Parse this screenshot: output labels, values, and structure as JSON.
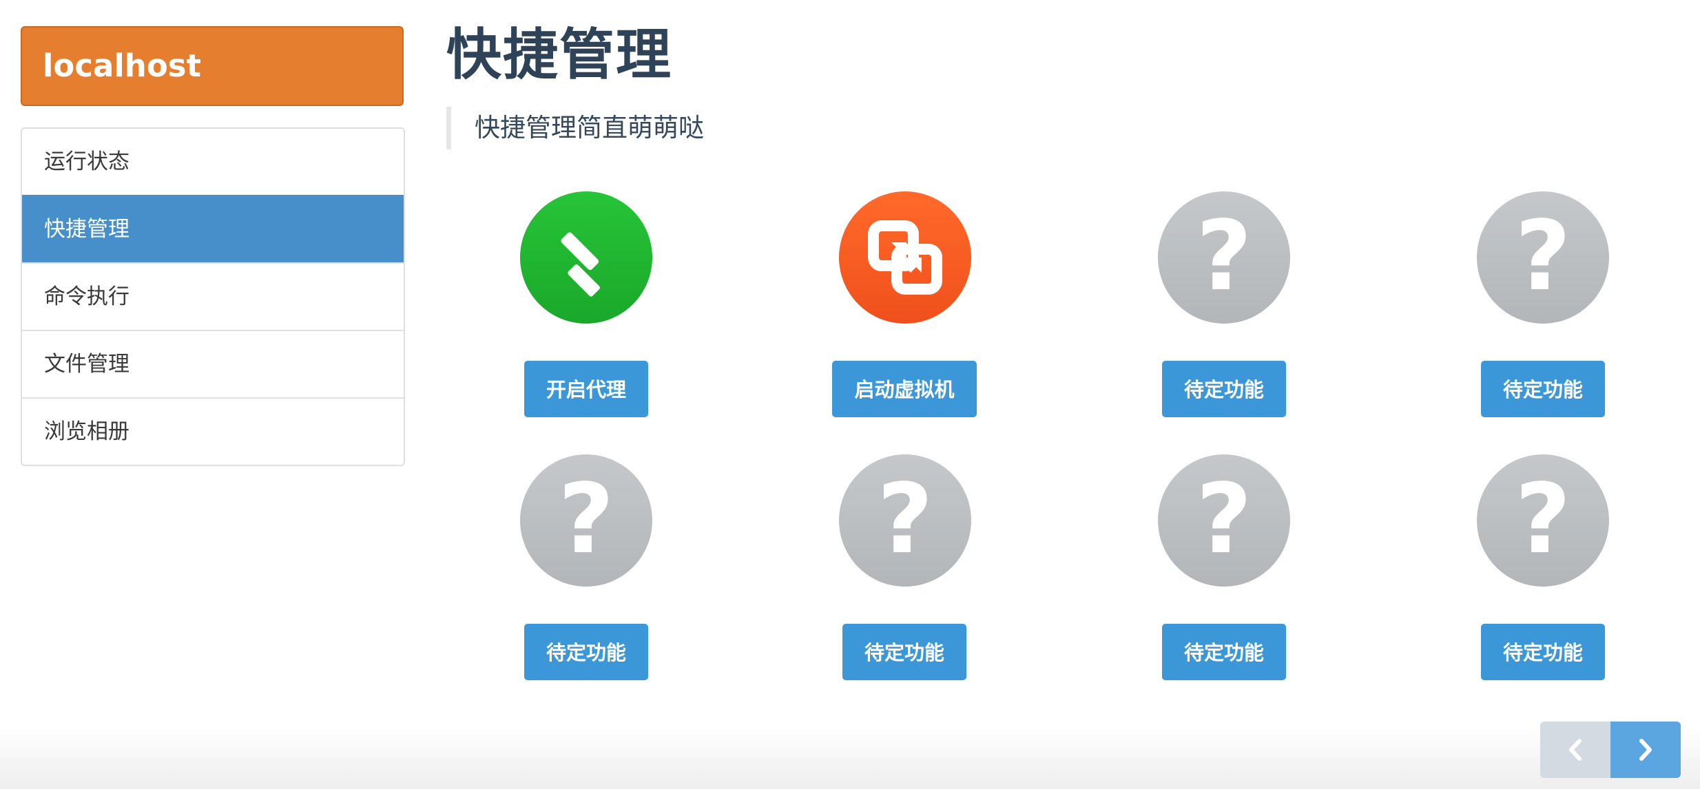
{
  "sidebar": {
    "brand": "localhost",
    "items": [
      {
        "label": "运行状态",
        "active": false
      },
      {
        "label": "快捷管理",
        "active": true
      },
      {
        "label": "命令执行",
        "active": false
      },
      {
        "label": "文件管理",
        "active": false
      },
      {
        "label": "浏览相册",
        "active": false
      }
    ]
  },
  "header": {
    "title": "快捷管理",
    "subtitle": "快捷管理简直萌萌哒"
  },
  "tiles": [
    {
      "icon": "feedly-icon",
      "label": "开启代理",
      "color": "#22bb33"
    },
    {
      "icon": "virtualbox-swap-icon",
      "label": "启动虚拟机",
      "color": "#fa5a20"
    },
    {
      "icon": "question-icon",
      "label": "待定功能",
      "color": "#bcbfc1"
    },
    {
      "icon": "question-icon",
      "label": "待定功能",
      "color": "#bcbfc1"
    },
    {
      "icon": "question-icon",
      "label": "待定功能",
      "color": "#bcbfc1"
    },
    {
      "icon": "question-icon",
      "label": "待定功能",
      "color": "#bcbfc1"
    },
    {
      "icon": "question-icon",
      "label": "待定功能",
      "color": "#bcbfc1"
    },
    {
      "icon": "question-icon",
      "label": "待定功能",
      "color": "#bcbfc1"
    }
  ],
  "pager": {
    "prev_icon": "chevron-left-icon",
    "next_icon": "chevron-right-icon"
  },
  "colors": {
    "brand": "#e67e30",
    "active_nav": "#478fca",
    "button": "#3c97d9",
    "title": "#2f4358"
  }
}
